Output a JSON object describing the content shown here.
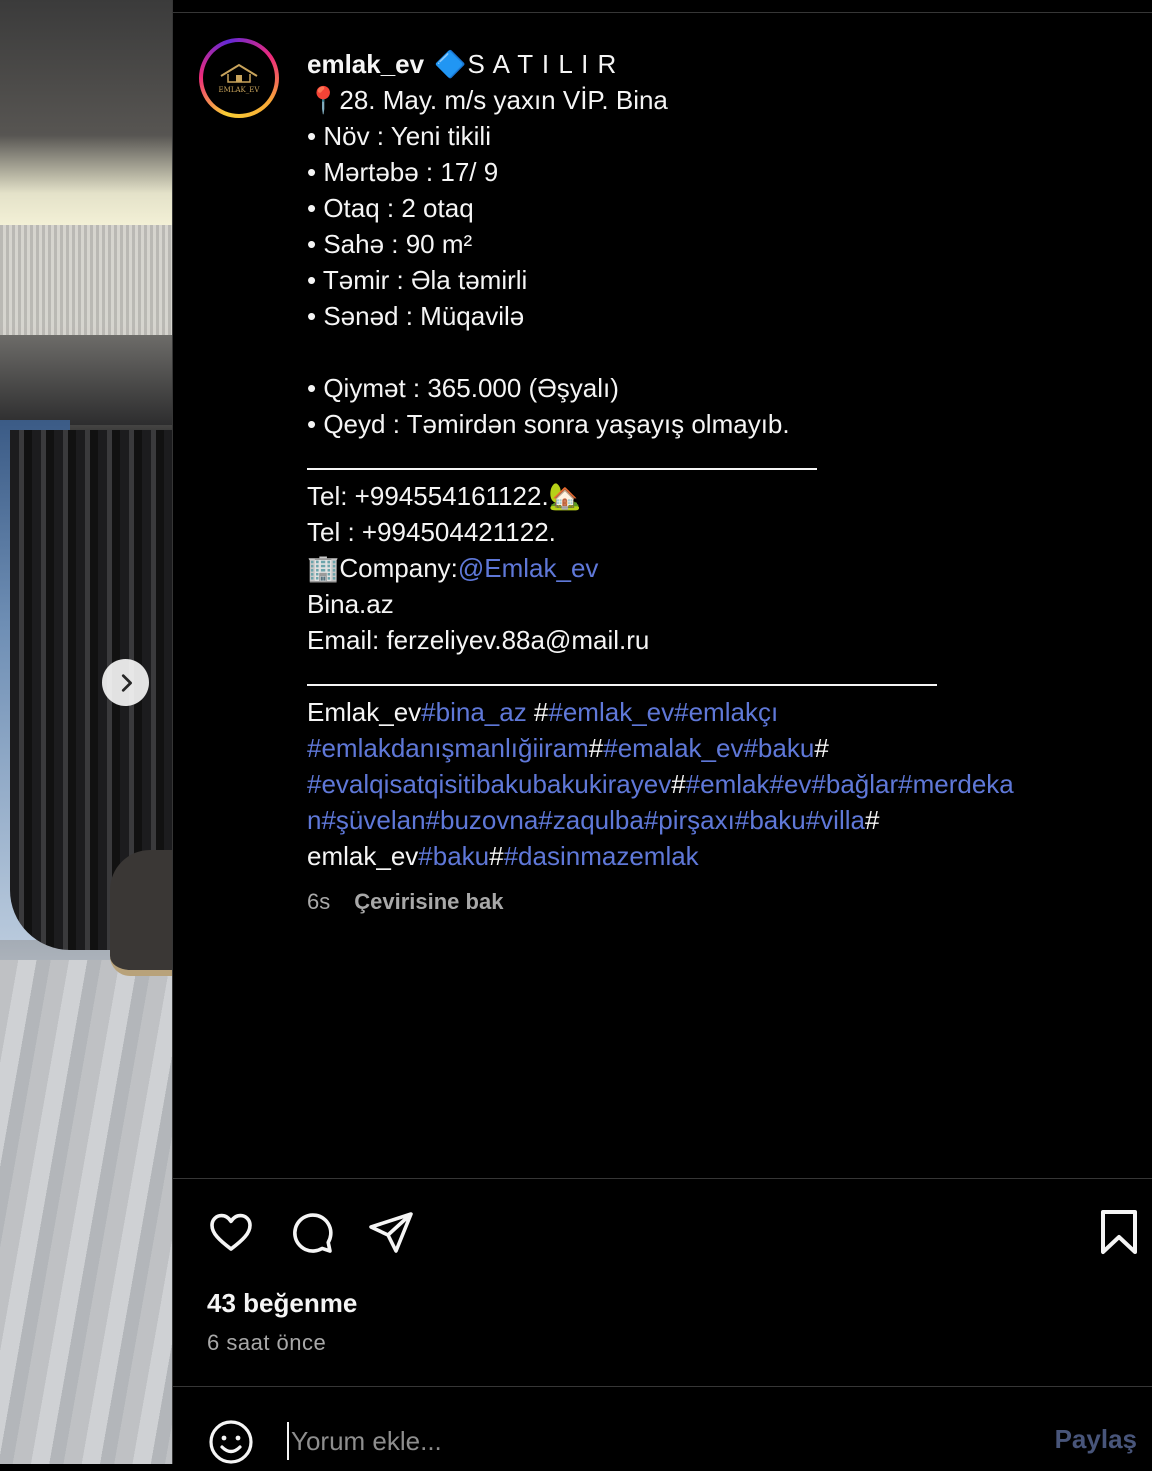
{
  "post": {
    "username": "emlak_ev",
    "avatar_text": "EMLAK_EV",
    "caption": {
      "l1_title": "🔷S A T I L I R",
      "l2": "📍28. May. m/s yaxın VİP. Bina",
      "l3": "• Növ : Yeni tikili",
      "l4": "• Mərtəbə : 17/ 9",
      "l5": "• Otaq : 2 otaq",
      "l6": "• Sahə : 90 m²",
      "l7": "• Təmir : Əla təmirli",
      "l8": "• Sənəd : Müqavilə",
      "l9": "• Qiymət : 365.000 (Əşyalı)",
      "l10": "• Qeyd : Təmirdən sonra yaşayış olmayıb.",
      "tel1": "Tel: +994554161122.🏡",
      "tel2": "Tel : +994504421122.",
      "company_prefix": "🏢Company:",
      "company_mention": "@Emlak_ev",
      "site": "Bina.az",
      "email": "Email: ferzeliyev.88a@mail.ru",
      "h1_a": "Emlak_ev",
      "h1_b": "#bina_az",
      "h1_c": " #",
      "h1_d": "#emlak_ev#emlakçı",
      "h2_a": "#emlakdanışmanlığiiram",
      "h2_b": "#",
      "h2_c": "#emalak_ev#baku",
      "h2_d": "#",
      "h3_a": "#evalqisatqisitibakubakukirayev",
      "h3_b": "#",
      "h3_c": "#emlak#ev#bağlar#merdeka",
      "h4_a": "n#şüvelan#buzovna#zaqulba#pirşaxı#baku#villa",
      "h4_b": "#",
      "h5_a": "emlak_ev",
      "h5_b": "#baku",
      "h5_c": "#",
      "h5_d": "#dasinmazemlak"
    },
    "caption_age": "6s",
    "translate_label": "Çevirisine bak",
    "likes": "43 beğenme",
    "time_ago": "6 saat önce"
  },
  "comment": {
    "placeholder": "Yorum ekle...",
    "share_label": "Paylaş"
  },
  "icons": {
    "like": "heart-icon",
    "comment": "comment-icon",
    "share": "send-icon",
    "save": "bookmark-icon",
    "emoji": "emoji-icon",
    "next": "chevron-right-icon"
  },
  "colors": {
    "background": "#000000",
    "text": "#f5f5f5",
    "hashtag": "#5f78d8",
    "muted": "#a8a8a8",
    "share_disabled": "#48557a"
  }
}
